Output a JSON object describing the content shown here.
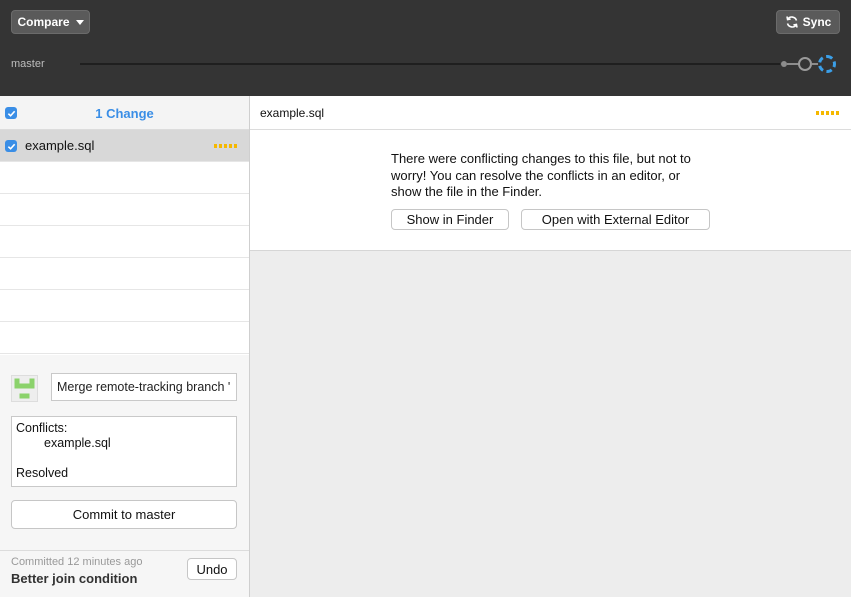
{
  "toolbar": {
    "compare_label": "Compare",
    "sync_label": "Sync",
    "branch_name": "master"
  },
  "changes": {
    "title": "1 Change",
    "files": [
      {
        "name": "example.sql",
        "checked": true,
        "status": "conflicted"
      }
    ]
  },
  "commit": {
    "summary_value": "Merge remote-tracking branch '",
    "description_lines": [
      "Conflicts:",
      "example.sql",
      "",
      "Resolved"
    ],
    "commit_button_label": "Commit to master"
  },
  "last_commit": {
    "time_label": "Committed 12 minutes ago",
    "message": "Better join condition",
    "undo_label": "Undo"
  },
  "diff": {
    "file_name": "example.sql",
    "conflict_message": "There were conflicting changes to this file, but not to worry! You can resolve the conflicts in an editor, or show the file in the Finder.",
    "show_in_finder_label": "Show in Finder",
    "open_editor_label": "Open with External Editor"
  },
  "colors": {
    "accent": "#3a8ee6",
    "conflict": "#f5b800",
    "toolbar_bg": "#343434"
  }
}
